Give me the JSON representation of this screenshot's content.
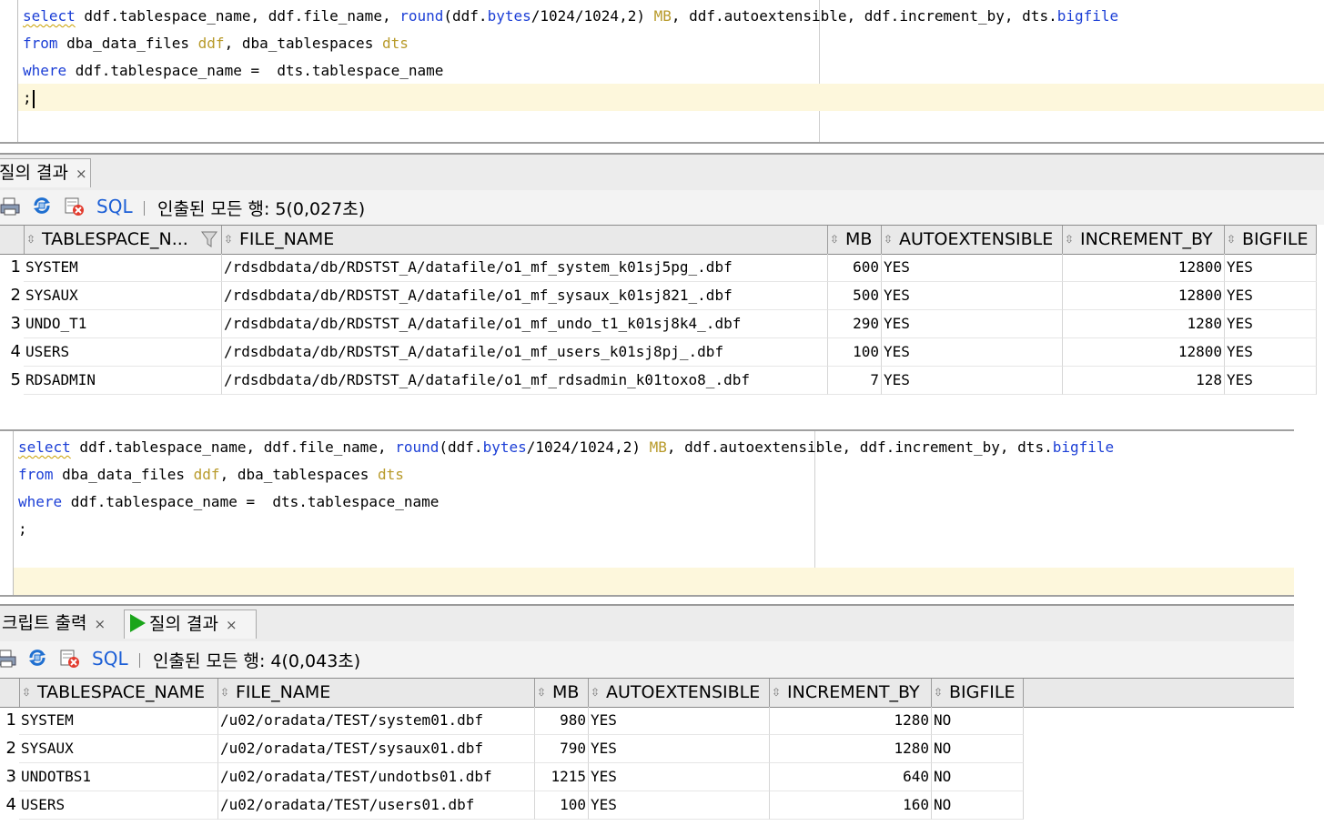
{
  "query_top": {
    "tokens": [
      [
        {
          "t": "select",
          "c": "kw kw-sq"
        },
        {
          "t": " ddf.tablespace_name, ddf.file_name, "
        },
        {
          "t": "round",
          "c": "kw"
        },
        {
          "t": "(ddf."
        },
        {
          "t": "bytes",
          "c": "kw"
        },
        {
          "t": "/1024/1024,2) "
        },
        {
          "t": "MB",
          "c": "al"
        },
        {
          "t": ", ddf.autoextensible, ddf.increment_by, dts."
        },
        {
          "t": "bigfile",
          "c": "kw"
        }
      ],
      [
        {
          "t": "from",
          "c": "kw"
        },
        {
          "t": " dba_data_files "
        },
        {
          "t": "ddf",
          "c": "al"
        },
        {
          "t": ", dba_tablespaces "
        },
        {
          "t": "dts",
          "c": "al"
        }
      ],
      [
        {
          "t": "where",
          "c": "kw"
        },
        {
          "t": " ddf.tablespace_name =  dts.tablespace_name"
        }
      ],
      [
        {
          "t": ";"
        }
      ]
    ]
  },
  "query_bottom": {
    "tokens": [
      [
        {
          "t": "select",
          "c": "kw kw-sq"
        },
        {
          "t": " ddf.tablespace_name, ddf.file_name, "
        },
        {
          "t": "round",
          "c": "kw"
        },
        {
          "t": "(ddf."
        },
        {
          "t": "bytes",
          "c": "kw"
        },
        {
          "t": "/1024/1024,2) "
        },
        {
          "t": "MB",
          "c": "al"
        },
        {
          "t": ", ddf.autoextensible, ddf.increment_by, dts."
        },
        {
          "t": "bigfile",
          "c": "kw"
        }
      ],
      [
        {
          "t": "from",
          "c": "kw"
        },
        {
          "t": " dba_data_files "
        },
        {
          "t": "ddf",
          "c": "al"
        },
        {
          "t": ", dba_tablespaces "
        },
        {
          "t": "dts",
          "c": "al"
        }
      ],
      [
        {
          "t": "where",
          "c": "kw"
        },
        {
          "t": " ddf.tablespace_name =  dts.tablespace_name"
        }
      ],
      [
        {
          "t": ";"
        }
      ]
    ]
  },
  "top_panel": {
    "tab_label": "질의 결과",
    "tab_close": "×",
    "sql_label": "SQL",
    "status": "인출된 모든 행: 5(0,027초)",
    "columns": [
      "TABLESPACE_N...",
      "FILE_NAME",
      "MB",
      "AUTOEXTENSIBLE",
      "INCREMENT_BY",
      "BIGFILE"
    ],
    "rows": [
      {
        "n": "1",
        "ts": "SYSTEM",
        "file": "/rdsdbdata/db/RDSTST_A/datafile/o1_mf_system_k01sj5pg_.dbf",
        "mb": "600",
        "auto": "YES",
        "inc": "12800",
        "big": "YES"
      },
      {
        "n": "2",
        "ts": "SYSAUX",
        "file": "/rdsdbdata/db/RDSTST_A/datafile/o1_mf_sysaux_k01sj821_.dbf",
        "mb": "500",
        "auto": "YES",
        "inc": "12800",
        "big": "YES"
      },
      {
        "n": "3",
        "ts": "UNDO_T1",
        "file": "/rdsdbdata/db/RDSTST_A/datafile/o1_mf_undo_t1_k01sj8k4_.dbf",
        "mb": "290",
        "auto": "YES",
        "inc": "1280",
        "big": "YES"
      },
      {
        "n": "4",
        "ts": "USERS",
        "file": "/rdsdbdata/db/RDSTST_A/datafile/o1_mf_users_k01sj8pj_.dbf",
        "mb": "100",
        "auto": "YES",
        "inc": "12800",
        "big": "YES"
      },
      {
        "n": "5",
        "ts": "RDSADMIN",
        "file": "/rdsdbdata/db/RDSTST_A/datafile/o1_mf_rdsadmin_k01toxo8_.dbf",
        "mb": "7",
        "auto": "YES",
        "inc": "128",
        "big": "YES"
      }
    ]
  },
  "bottom_panel": {
    "tab_script_label": "크립트 출력",
    "tab_result_label": "질의 결과",
    "tab_close": "×",
    "sql_label": "SQL",
    "status": "인출된 모든 행: 4(0,043초)",
    "columns": [
      "TABLESPACE_NAME",
      "FILE_NAME",
      "MB",
      "AUTOEXTENSIBLE",
      "INCREMENT_BY",
      "BIGFILE"
    ],
    "rows": [
      {
        "n": "1",
        "ts": "SYSTEM",
        "file": "/u02/oradata/TEST/system01.dbf",
        "mb": "980",
        "auto": "YES",
        "inc": "1280",
        "big": "NO"
      },
      {
        "n": "2",
        "ts": "SYSAUX",
        "file": "/u02/oradata/TEST/sysaux01.dbf",
        "mb": "790",
        "auto": "YES",
        "inc": "1280",
        "big": "NO"
      },
      {
        "n": "3",
        "ts": "UNDOTBS1",
        "file": "/u02/oradata/TEST/undotbs01.dbf",
        "mb": "1215",
        "auto": "YES",
        "inc": "640",
        "big": "NO"
      },
      {
        "n": "4",
        "ts": "USERS",
        "file": "/u02/oradata/TEST/users01.dbf",
        "mb": "100",
        "auto": "YES",
        "inc": "160",
        "big": "NO"
      }
    ]
  }
}
